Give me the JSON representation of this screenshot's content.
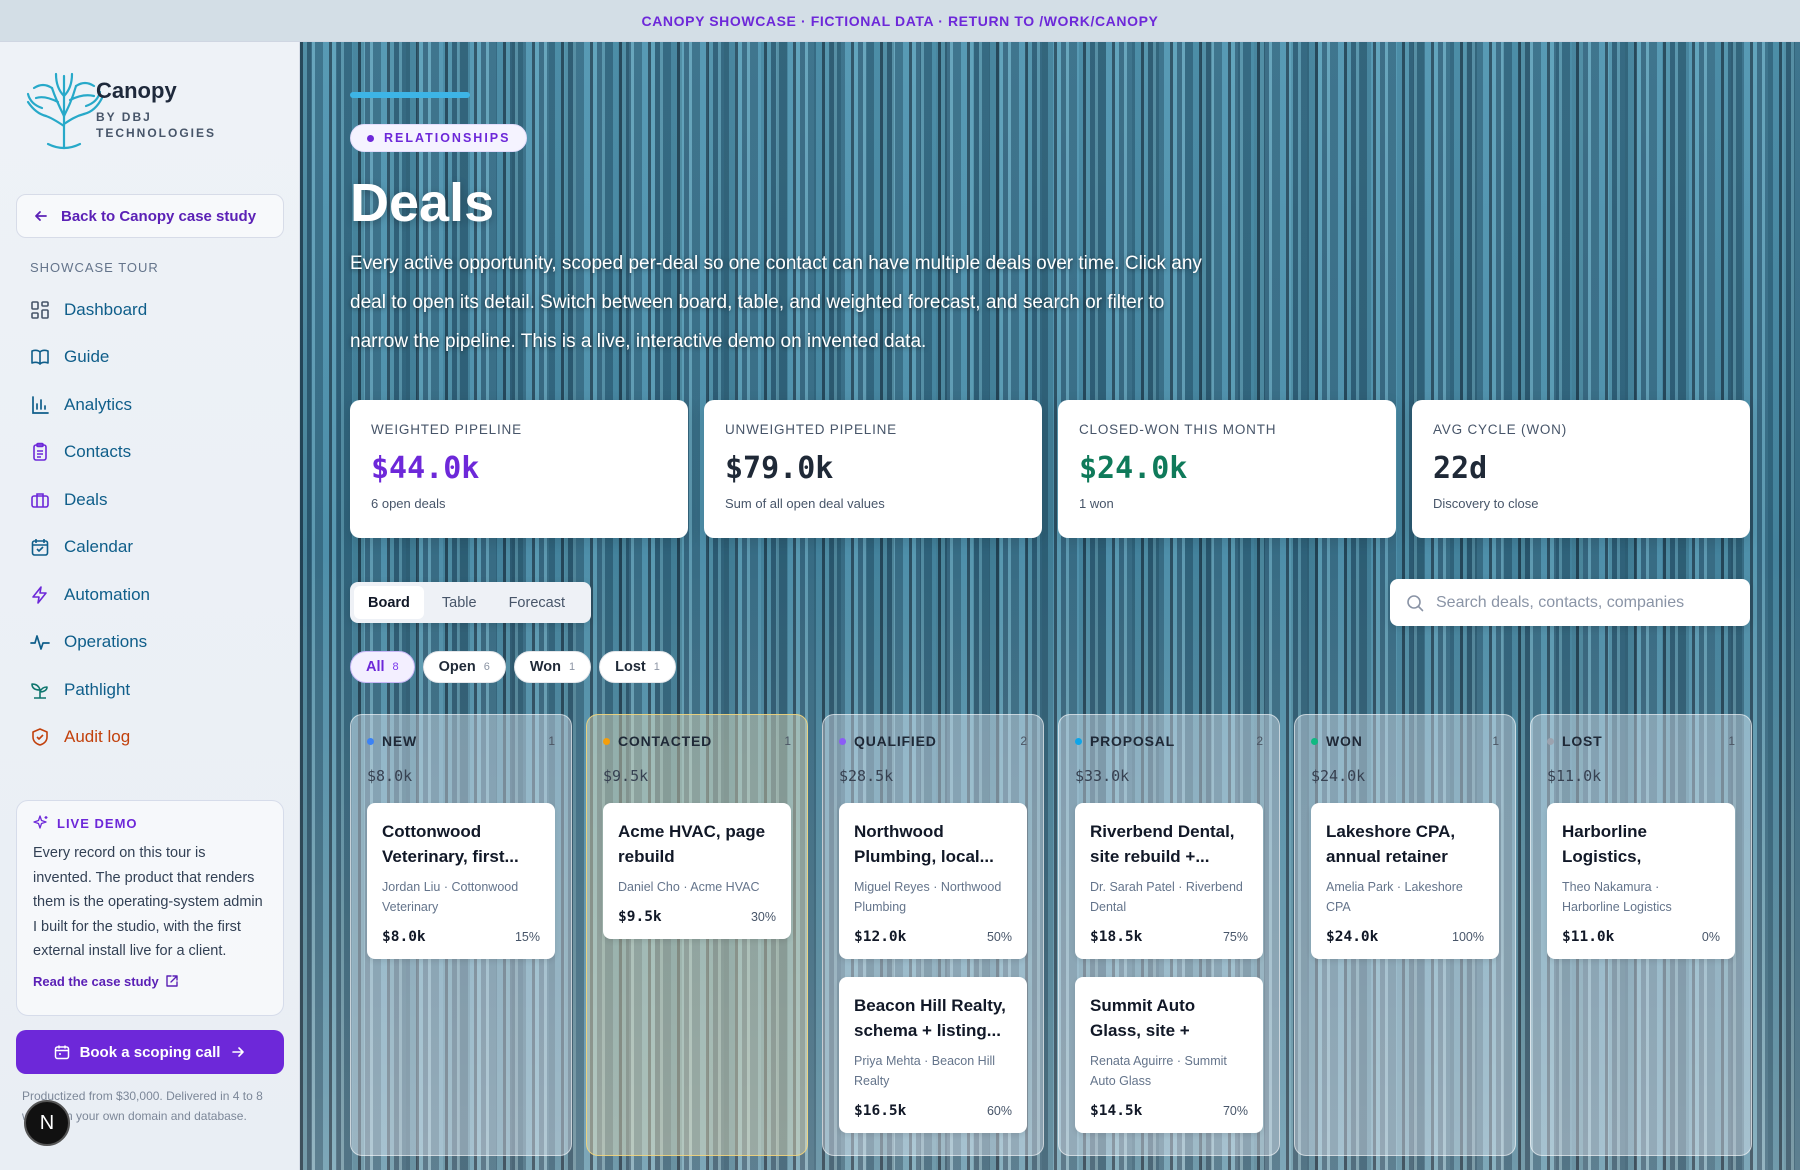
{
  "banner": {
    "text": "CANOPY SHOWCASE · FICTIONAL DATA · RETURN TO /WORK/CANOPY"
  },
  "brand": {
    "name": "Canopy",
    "sub": "BY DBJ TECHNOLOGIES"
  },
  "sidebar": {
    "back_label": "Back to Canopy case study",
    "section_label": "SHOWCASE TOUR",
    "items": [
      {
        "label": "Dashboard",
        "icon": "dashboard-icon",
        "color": "#0f5e8a"
      },
      {
        "label": "Guide",
        "icon": "book-icon",
        "color": "#0f5e8a"
      },
      {
        "label": "Analytics",
        "icon": "bar-chart-icon",
        "color": "#0f5e8a"
      },
      {
        "label": "Contacts",
        "icon": "clipboard-icon",
        "color": "#6d28d9"
      },
      {
        "label": "Deals",
        "icon": "briefcase-icon",
        "color": "#6d28d9"
      },
      {
        "label": "Calendar",
        "icon": "calendar-icon",
        "color": "#0f5e8a"
      },
      {
        "label": "Automation",
        "icon": "bolt-icon",
        "color": "#6d28d9"
      },
      {
        "label": "Operations",
        "icon": "pulse-icon",
        "color": "#0f5e8a"
      },
      {
        "label": "Pathlight",
        "icon": "sprout-icon",
        "color": "#0f766e"
      },
      {
        "label": "Audit log",
        "icon": "shield-icon",
        "color": "#c2410c"
      }
    ],
    "live": {
      "title": "LIVE DEMO",
      "text": "Every record on this tour is invented. The product that renders them is the operating-system admin I built for the studio, with the first external install live for a client.",
      "link": "Read the case study"
    },
    "book_label": "Book a scoping call",
    "footnote": "Productized from $30,000. Delivered in 4 to 8 weeks on your own domain and database.",
    "avatar_initial": "N"
  },
  "header": {
    "section": "RELATIONSHIPS",
    "title": "Deals",
    "description": "Every active opportunity, scoped per-deal so one contact can have multiple deals over time. Click any deal to open its detail. Switch between board, table, and weighted forecast, and search or filter to narrow the pipeline. This is a live, interactive demo on invented data."
  },
  "stats": [
    {
      "label": "WEIGHTED PIPELINE",
      "value": "$44.0k",
      "sub": "6 open deals",
      "color": "#6d28d9"
    },
    {
      "label": "UNWEIGHTED PIPELINE",
      "value": "$79.0k",
      "sub": "Sum of all open deal values",
      "color": "#1f2937"
    },
    {
      "label": "CLOSED-WON THIS MONTH",
      "value": "$24.0k",
      "sub": "1 won",
      "color": "#0f7a5a"
    },
    {
      "label": "AVG CYCLE (WON)",
      "value": "22d",
      "sub": "Discovery to close",
      "color": "#1f2937"
    }
  ],
  "views": {
    "board": "Board",
    "table": "Table",
    "forecast": "Forecast",
    "active": "Board"
  },
  "search": {
    "placeholder": "Search deals, contacts, companies",
    "value": ""
  },
  "filters": [
    {
      "label": "All",
      "count": "8",
      "active": true
    },
    {
      "label": "Open",
      "count": "6",
      "active": false
    },
    {
      "label": "Won",
      "count": "1",
      "active": false
    },
    {
      "label": "Lost",
      "count": "1",
      "active": false
    }
  ],
  "columns": [
    {
      "name": "NEW",
      "count": "1",
      "total": "$8.0k",
      "dot": "#3b82f6",
      "highlight": false,
      "cards": [
        {
          "title": "Cottonwood Veterinary, first...",
          "meta": "Jordan Liu · Cottonwood Veterinary",
          "value": "$8.0k",
          "pct": "15%"
        }
      ]
    },
    {
      "name": "CONTACTED",
      "count": "1",
      "total": "$9.5k",
      "dot": "#f59e0b",
      "highlight": true,
      "cards": [
        {
          "title": "Acme HVAC, page rebuild",
          "meta": "Daniel Cho · Acme HVAC",
          "value": "$9.5k",
          "pct": "30%"
        }
      ]
    },
    {
      "name": "QUALIFIED",
      "count": "2",
      "total": "$28.5k",
      "dot": "#8b5cf6",
      "highlight": false,
      "cards": [
        {
          "title": "Northwood Plumbing, local...",
          "meta": "Miguel Reyes · Northwood Plumbing",
          "value": "$12.0k",
          "pct": "50%"
        },
        {
          "title": "Beacon Hill Realty, schema + listing...",
          "meta": "Priya Mehta · Beacon Hill Realty",
          "value": "$16.5k",
          "pct": "60%"
        }
      ]
    },
    {
      "name": "PROPOSAL",
      "count": "2",
      "total": "$33.0k",
      "dot": "#0ea5e9",
      "highlight": false,
      "cards": [
        {
          "title": "Riverbend Dental, site rebuild +...",
          "meta": "Dr. Sarah Patel · Riverbend Dental",
          "value": "$18.5k",
          "pct": "75%"
        },
        {
          "title": "Summit Auto Glass, site + booking flow",
          "meta": "Renata Aguirre · Summit Auto Glass",
          "value": "$14.5k",
          "pct": "70%"
        }
      ]
    },
    {
      "name": "WON",
      "count": "1",
      "total": "$24.0k",
      "dot": "#10b981",
      "highlight": false,
      "cards": [
        {
          "title": "Lakeshore CPA, annual retainer",
          "meta": "Amelia Park · Lakeshore CPA",
          "value": "$24.0k",
          "pct": "100%"
        }
      ]
    },
    {
      "name": "LOST",
      "count": "1",
      "total": "$11.0k",
      "dot": "#9ca3af",
      "highlight": false,
      "cards": [
        {
          "title": "Harborline Logistics, discove...",
          "meta": "Theo Nakamura · Harborline Logistics",
          "value": "$11.0k",
          "pct": "0%"
        }
      ]
    }
  ]
}
